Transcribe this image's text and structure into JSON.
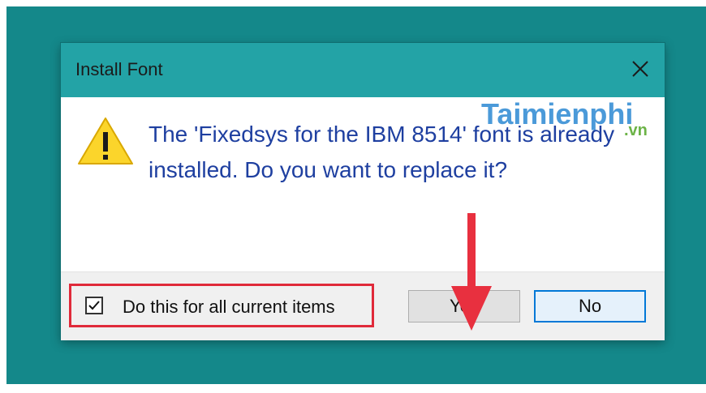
{
  "dialog": {
    "title": "Install Font",
    "message": "The 'Fixedsys for the IBM 8514' font is already installed. Do you want to replace it?",
    "icons": {
      "warning": "warning-icon",
      "close": "close-icon",
      "check": "checkmark-icon",
      "arrow": "arrow-down-icon"
    },
    "checkbox": {
      "label": "Do this for all current items",
      "checked": true
    },
    "buttons": {
      "yes": "Yes",
      "no": "No"
    }
  },
  "watermark": {
    "brand": "Taimienphi",
    "suffix": ".vn"
  },
  "colors": {
    "background": "#14888a",
    "titlebar": "#23a3a6",
    "message_text": "#1e3fa0",
    "highlight": "#e02a3a",
    "no_button_border": "#0078d7"
  }
}
